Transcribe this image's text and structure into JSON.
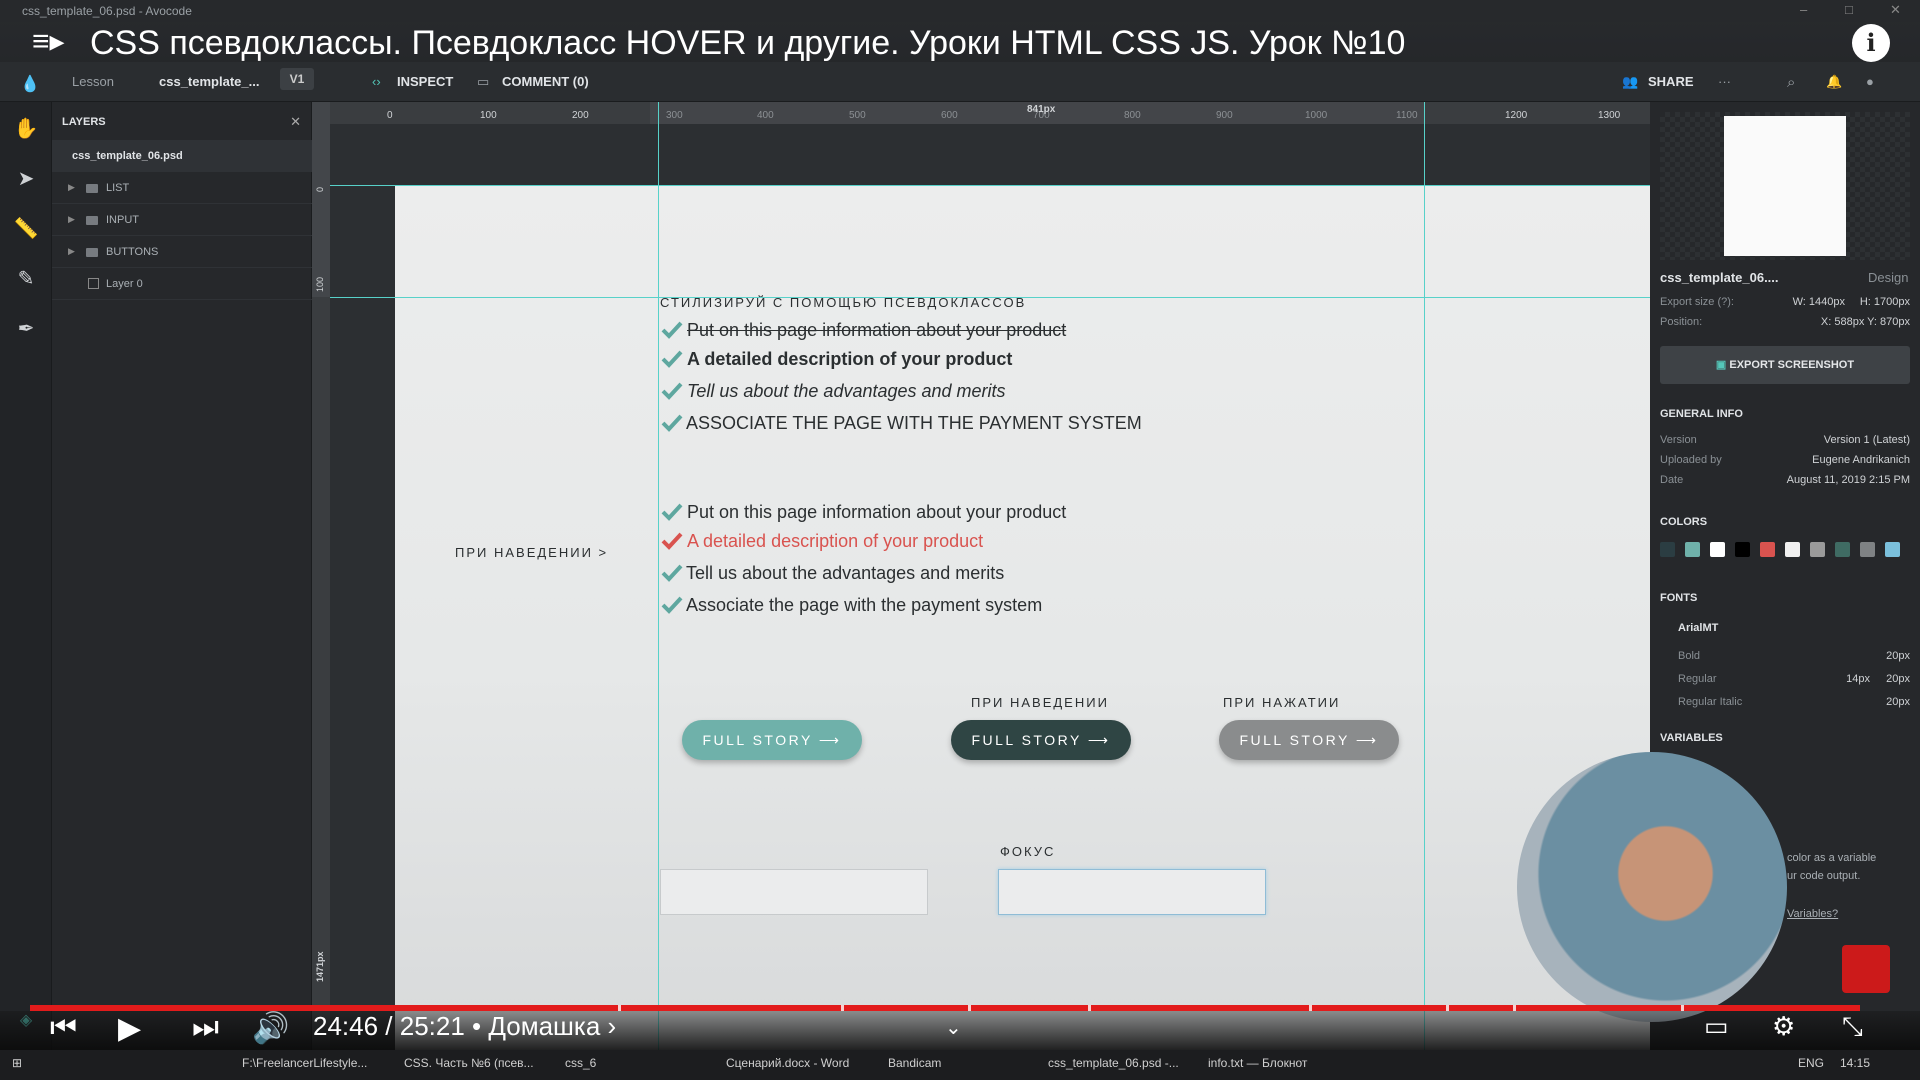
{
  "window": {
    "title": "css_template_06.psd - Avocode"
  },
  "video": {
    "title": "CSS псевдоклассы. Псевдокласс HOVER и другие. Уроки HTML CSS JS. Урок №10",
    "time": "24:46 / 25:21 • Домашка ›"
  },
  "toolbar": {
    "lesson": "Lesson",
    "file": "css_template_...",
    "version": "V1",
    "inspect": "INSPECT",
    "comment": "COMMENT (0)",
    "share": "SHARE"
  },
  "layers": {
    "header": "LAYERS",
    "file": "css_template_06.psd",
    "items": [
      {
        "label": "LIST",
        "type": "folder"
      },
      {
        "label": "INPUT",
        "type": "folder"
      },
      {
        "label": "BUTTONS",
        "type": "folder"
      },
      {
        "label": "Layer 0",
        "type": "image"
      }
    ]
  },
  "ruler": {
    "top": [
      "0",
      "100",
      "200",
      "1200",
      "1300"
    ],
    "dim_top": [
      "300",
      "400",
      "500",
      "600",
      "700",
      "800",
      "900",
      "1000",
      "1100"
    ],
    "width_label": "841px",
    "left": [
      "0",
      "100"
    ],
    "height_label": "1471px"
  },
  "design": {
    "heading": "СТИЛИЗИРУЙ С ПОМОЩЬЮ ПСЕВДОКЛАССОВ",
    "list1": [
      "Put on this page information about your product",
      "A detailed description of your product",
      "Tell us about the advantages and merits",
      "ASSOCIATE THE PAGE WITH THE PAYMENT SYSTEM"
    ],
    "hover_label": "ПРИ НАВЕДЕНИИ >",
    "list2": [
      "Put on this page information about your product",
      "A detailed description of your product",
      "Tell us about the advantages and merits",
      "Associate the page with the payment system"
    ],
    "btn_hover_caption": "ПРИ НАВЕДЕНИИ",
    "btn_active_caption": "ПРИ НАЖАТИИ",
    "button_label": "FULL STORY ⟶",
    "focus_caption": "ФОКУС",
    "colors": {
      "teal": "#6fb1aa",
      "dark": "#2f4544",
      "gray": "#8a8c8d",
      "red": "#d9534f",
      "check": "#5ea79f"
    }
  },
  "inspector": {
    "name": "css_template_06....",
    "mode": "Design",
    "export_size_label": "Export size (?):",
    "w": "W: 1440px",
    "h": "H: 1700px",
    "position_label": "Position:",
    "position": "X: 588px Y: 870px",
    "export_btn": "EXPORT SCREENSHOT",
    "general": "GENERAL INFO",
    "version_label": "Version",
    "version": "Version 1 (Latest)",
    "uploaded_label": "Uploaded by",
    "uploaded": "Eugene Andrikanich",
    "date_label": "Date",
    "date": "August 11, 2019 2:15 PM",
    "colors_title": "COLORS",
    "swatches": [
      "#2b3d42",
      "#6fb1aa",
      "#ffffff",
      "#000000",
      "#d9534f",
      "#f0f0f0",
      "#9a9a9a",
      "#3f6b63",
      "#7f8284",
      "#7bc0dc"
    ],
    "fonts_title": "FONTS",
    "font_name": "ArialMT",
    "font_styles": [
      {
        "name": "Bold",
        "sizes": [
          "20px"
        ]
      },
      {
        "name": "Regular",
        "sizes": [
          "14px",
          "20px"
        ]
      },
      {
        "name": "Regular Italic",
        "sizes": [
          "20px"
        ]
      }
    ],
    "variables_title": "VARIABLES",
    "variables_text": "color as a variable",
    "variables_text2": "ur code output.",
    "variables_link": "Variables?"
  },
  "taskbar": {
    "items": [
      "F:\\FreelancerLifestyle...",
      "CSS. Часть №6 (псев...",
      "css_6",
      "Сценарий.docx - Word",
      "Bandicam",
      "css_template_06.psd -...",
      "info.txt — Блокнот"
    ],
    "lang": "ENG",
    "clock": "14:15"
  }
}
